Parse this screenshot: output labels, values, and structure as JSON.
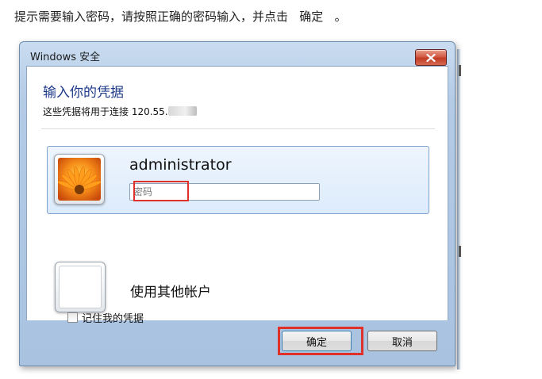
{
  "instruction": {
    "text": "提示需要输入密码，请按照正确的密码输入，并点击   确定   。"
  },
  "window": {
    "title": "Windows 安全",
    "heading": "输入你的凭据",
    "subheading": "这些凭据将用于连接 120.55.",
    "credential": {
      "username": "administrator",
      "password_placeholder": "密码"
    },
    "other_account_label": "使用其他帐户",
    "remember_label": "记住我的凭据",
    "remember_checked": false,
    "ok_label": "确定",
    "cancel_label": "取消"
  },
  "colors": {
    "heading": "#1e3a8a",
    "highlight": "#e0302a",
    "tile_selected": "#dcebfc"
  },
  "icons": {
    "close": "close-icon",
    "avatar_user": "flower-avatar",
    "avatar_other": "blank-avatar"
  }
}
